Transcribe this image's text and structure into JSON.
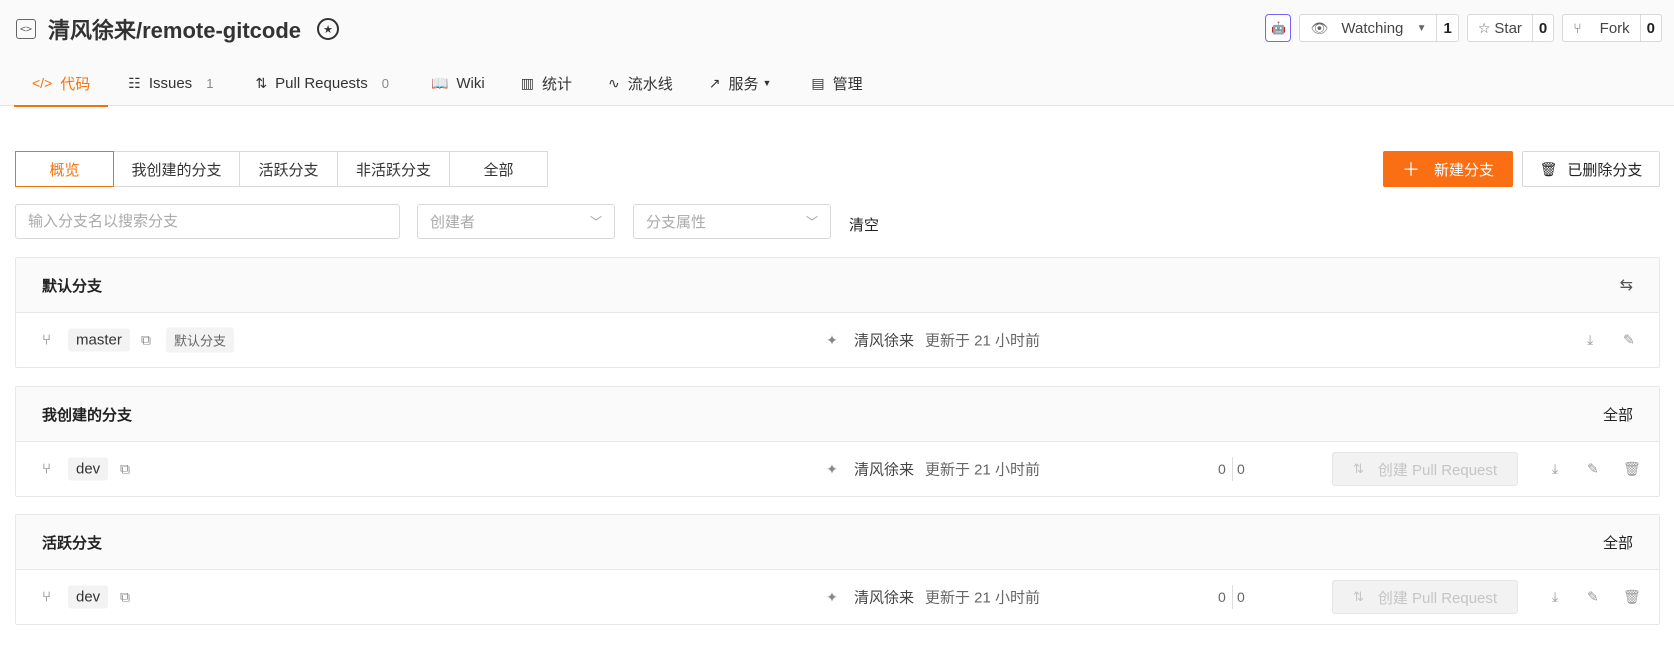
{
  "repo": {
    "title": "清风徐来/remote-gitcode"
  },
  "actions": {
    "watch_label": "Watching",
    "watch_count": "1",
    "star_label": "Star",
    "star_count": "0",
    "fork_label": "Fork",
    "fork_count": "0"
  },
  "tabs": [
    {
      "label": "代码",
      "count": ""
    },
    {
      "label": "Issues",
      "count": "1"
    },
    {
      "label": "Pull Requests",
      "count": "0"
    },
    {
      "label": "Wiki",
      "count": ""
    },
    {
      "label": "统计",
      "count": ""
    },
    {
      "label": "流水线",
      "count": ""
    },
    {
      "label": "服务",
      "count": ""
    },
    {
      "label": "管理",
      "count": ""
    }
  ],
  "filters": {
    "segments": [
      "概览",
      "我创建的分支",
      "活跃分支",
      "非活跃分支",
      "全部"
    ],
    "new_branch": "新建分支",
    "deleted_branch": "已删除分支",
    "search_placeholder": "输入分支名以搜索分支",
    "creator_placeholder": "创建者",
    "attr_placeholder": "分支属性",
    "clear": "清空"
  },
  "sections": [
    {
      "title": "默认分支",
      "link": "",
      "rows": [
        {
          "name": "master",
          "tag": "默认分支",
          "author": "清风徐来",
          "updated": "更新于 21 小时前"
        }
      ]
    },
    {
      "title": "我创建的分支",
      "link": "全部",
      "rows": [
        {
          "name": "dev",
          "author": "清风徐来",
          "updated": "更新于 21 小时前",
          "behind": "0",
          "ahead": "0",
          "pr_label": "创建 Pull Request"
        }
      ]
    },
    {
      "title": "活跃分支",
      "link": "全部",
      "rows": [
        {
          "name": "dev",
          "author": "清风徐来",
          "updated": "更新于 21 小时前",
          "behind": "0",
          "ahead": "0",
          "pr_label": "创建 Pull Request"
        }
      ]
    }
  ],
  "colors": {
    "accent": "#fa6e14",
    "tab_active": "#f2730c"
  }
}
